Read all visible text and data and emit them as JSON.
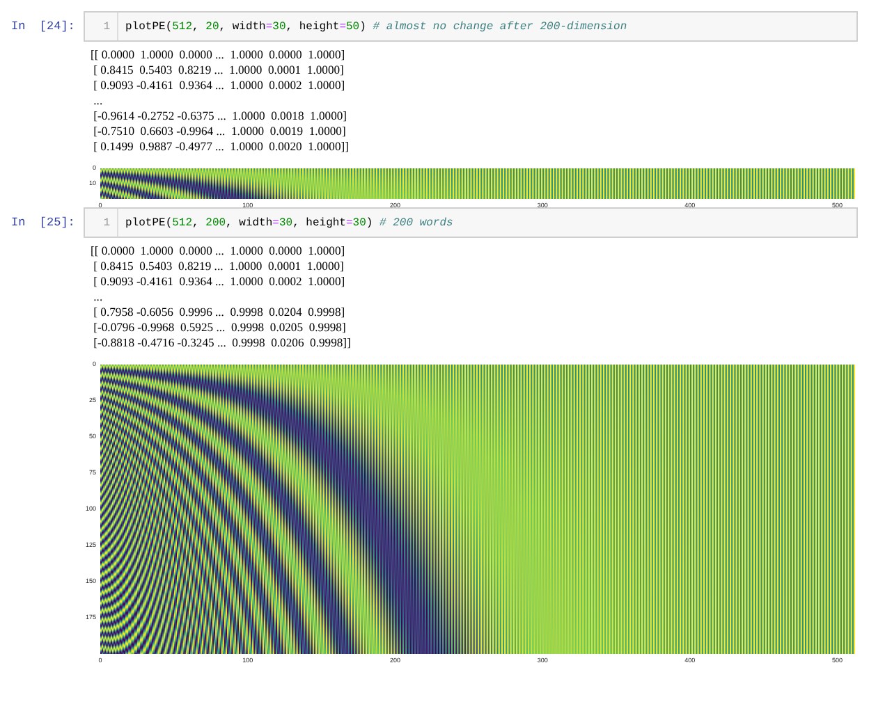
{
  "cells": [
    {
      "prompt": "In  [24]:",
      "line_number": "1",
      "code": [
        {
          "kind": "name",
          "text": "plotPE"
        },
        {
          "kind": "punct",
          "text": "("
        },
        {
          "kind": "number",
          "text": "512"
        },
        {
          "kind": "punct",
          "text": ", "
        },
        {
          "kind": "number",
          "text": "20"
        },
        {
          "kind": "punct",
          "text": ", width"
        },
        {
          "kind": "operator",
          "text": "="
        },
        {
          "kind": "number",
          "text": "30"
        },
        {
          "kind": "punct",
          "text": ", height"
        },
        {
          "kind": "operator",
          "text": "="
        },
        {
          "kind": "number",
          "text": "50"
        },
        {
          "kind": "punct",
          "text": ") "
        },
        {
          "kind": "comment",
          "text": "# almost no change after 200-dimension"
        }
      ],
      "output_lines": [
        "[[ 0.0000  1.0000  0.0000 ...  1.0000  0.0000  1.0000]",
        " [ 0.8415  0.5403  0.8219 ...  1.0000  0.0001  1.0000]",
        " [ 0.9093 -0.4161  0.9364 ...  1.0000  0.0002  1.0000]",
        " ...",
        " [-0.9614 -0.2752 -0.6375 ...  1.0000  0.0018  1.0000]",
        " [-0.7510  0.6603 -0.9964 ...  1.0000  0.0019  1.0000]",
        " [ 0.1499  0.9887 -0.4977 ...  1.0000  0.0020  1.0000]]"
      ],
      "plot": {
        "y_ticks": [
          "0",
          "10"
        ],
        "x_ticks": [
          "0",
          "100",
          "200",
          "300",
          "400",
          "500"
        ]
      }
    },
    {
      "prompt": "In  [25]:",
      "line_number": "1",
      "code": [
        {
          "kind": "name",
          "text": "plotPE"
        },
        {
          "kind": "punct",
          "text": "("
        },
        {
          "kind": "number",
          "text": "512"
        },
        {
          "kind": "punct",
          "text": ", "
        },
        {
          "kind": "number",
          "text": "200"
        },
        {
          "kind": "punct",
          "text": ", width"
        },
        {
          "kind": "operator",
          "text": "="
        },
        {
          "kind": "number",
          "text": "30"
        },
        {
          "kind": "punct",
          "text": ", height"
        },
        {
          "kind": "operator",
          "text": "="
        },
        {
          "kind": "number",
          "text": "30"
        },
        {
          "kind": "punct",
          "text": ") "
        },
        {
          "kind": "comment",
          "text": "# 200 words"
        }
      ],
      "output_lines": [
        "[[ 0.0000  1.0000  0.0000 ...  1.0000  0.0000  1.0000]",
        " [ 0.8415  0.5403  0.8219 ...  1.0000  0.0001  1.0000]",
        " [ 0.9093 -0.4161  0.9364 ...  1.0000  0.0002  1.0000]",
        " ...",
        " [ 0.7958 -0.6056  0.9996 ...  0.9998  0.0204  0.9998]",
        " [-0.0796 -0.9968  0.5925 ...  0.9998  0.0205  0.9998]",
        " [-0.8818 -0.4716 -0.3245 ...  0.9998  0.0206  0.9998]]"
      ],
      "plot": {
        "y_ticks": [
          "0",
          "25",
          "50",
          "75",
          "100",
          "125",
          "150",
          "175"
        ],
        "x_ticks": [
          "0",
          "100",
          "200",
          "300",
          "400",
          "500"
        ]
      }
    }
  ]
}
